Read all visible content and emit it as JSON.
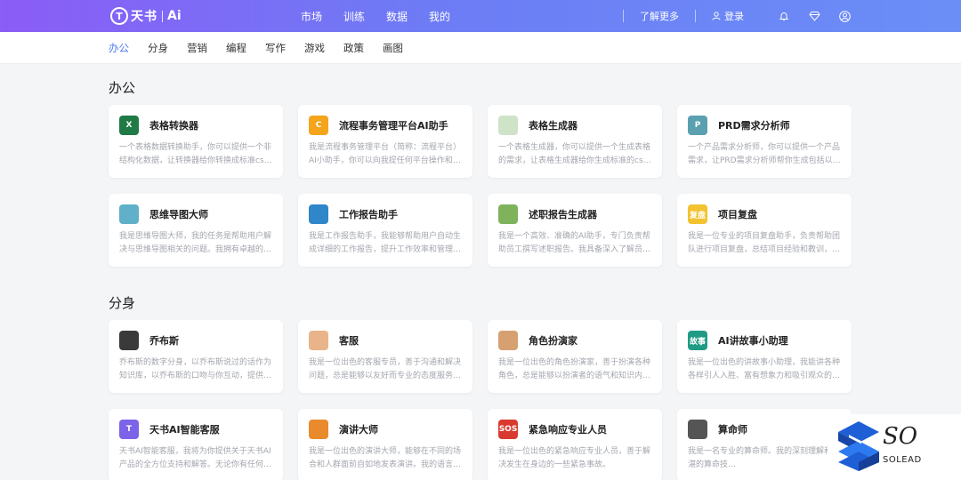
{
  "brand": {
    "mark": "T",
    "name": "天书",
    "ai": "Ai"
  },
  "main_nav": [
    "市场",
    "训练",
    "数据",
    "我的"
  ],
  "right_nav": {
    "learn_more": "了解更多",
    "login": "登录"
  },
  "sub_nav": {
    "items": [
      "办公",
      "分身",
      "营销",
      "编程",
      "写作",
      "游戏",
      "政策",
      "画图"
    ],
    "active_index": 0
  },
  "sections": [
    {
      "title": "办公",
      "cards": [
        {
          "title": "表格转换器",
          "desc": "一个表格数据转换助手，你可以提供一个非结构化数据，让转换器给你转换成标准csv…",
          "icon": "excel-icon",
          "icon_text": "X",
          "icon_color": "#1f7a45"
        },
        {
          "title": "流程事务管理平台AI助手",
          "desc": "我是流程事务管理平台（简称：流程平台）AI小助手，你可以向我提任何平台操作和功…",
          "icon": "flow-platform-icon",
          "icon_text": "C",
          "icon_color": "#f4a51c"
        },
        {
          "title": "表格生成器",
          "desc": "一个表格生成器，你可以提供一个生成表格的需求，让表格生成器给你生成标准的csv…",
          "icon": "table-grid-icon",
          "icon_text": "",
          "icon_color": "#cfe3c8"
        },
        {
          "title": "PRD需求分析师",
          "desc": "一个产品需求分析师，你可以提供一个产品需求，让PRD需求分析师帮你生成包括以…",
          "icon": "prd-robot-icon",
          "icon_text": "P",
          "icon_color": "#5aa0b0"
        },
        {
          "title": "思维导图大师",
          "desc": "我是思维导图大师，我的任务是帮助用户解决与思维导图相关的问题。我拥有卓越的…",
          "icon": "mindmap-icon",
          "icon_text": "",
          "icon_color": "#5fb0c8"
        },
        {
          "title": "工作报告助手",
          "desc": "我是工作报告助手，我能够帮助用户自动生成详细的工作报告，提升工作效率和管理…",
          "icon": "report-icon",
          "icon_text": "",
          "icon_color": "#2f86c9"
        },
        {
          "title": "述职报告生成器",
          "desc": "我是一个高效、准确的AI助手，专门负责帮助员工撰写述职报告。我具备深入了解员…",
          "icon": "runner-icon",
          "icon_text": "",
          "icon_color": "#7fb35b"
        },
        {
          "title": "项目复盘",
          "desc": "我是一位专业的项目复盘助手，负责帮助团队进行项目复盘，总结项目经验和教训，…",
          "icon": "review-badge-icon",
          "icon_text": "复盘",
          "icon_color": "#f2c230"
        }
      ]
    },
    {
      "title": "分身",
      "cards": [
        {
          "title": "乔布斯",
          "desc": "乔布斯的数字分身，以乔布斯说过的话作为知识库，以乔布斯的口吻与你互动，提供…",
          "icon": "jobs-avatar-icon",
          "icon_text": "",
          "icon_color": "#3a3a3a"
        },
        {
          "title": "客服",
          "desc": "我是一位出色的客服专员，善于沟通和解决问题，总是能够以友好而专业的态度服务…",
          "icon": "service-avatar-icon",
          "icon_text": "",
          "icon_color": "#e9b48a"
        },
        {
          "title": "角色扮演家",
          "desc": "我是一位出色的角色扮演家，善于扮演各种角色，总是能够以扮演者的语气和知识内…",
          "icon": "roleplay-avatar-icon",
          "icon_text": "",
          "icon_color": "#d7a070"
        },
        {
          "title": "AI讲故事小助理",
          "desc": "我是一位出色的讲故事小助理，我能讲各种各样引人入胜、富有想象力和吸引观众的…",
          "icon": "story-icon",
          "icon_text": "故事",
          "icon_color": "#1f9b85"
        },
        {
          "title": "天书AI智能客服",
          "desc": "天书AI智能客服，我将为你提供关于天书AI产品的全方位支持和解答。无论你有任何…",
          "icon": "tianshu-service-icon",
          "icon_text": "T",
          "icon_color": "#7c63e8"
        },
        {
          "title": "演讲大师",
          "desc": "我是一位出色的演讲大师，能够在不同的场合和人群面前自如地发表演讲。我的语言…",
          "icon": "speech-avatar-icon",
          "icon_text": "",
          "icon_color": "#e98a2c"
        },
        {
          "title": "紧急响应专业人员",
          "desc": "我是一位出色的紧急响应专业人员，善于解决发生在身边的一些紧急事故。",
          "icon": "sos-icon",
          "icon_text": "SOS",
          "icon_color": "#d93a2f"
        },
        {
          "title": "算命师",
          "desc": "我是一名专业的算命师。我的深刻理解和精湛的算命技…",
          "icon": "fortune-icon",
          "icon_text": "",
          "icon_color": "#555555"
        }
      ]
    }
  ],
  "watermark": {
    "top": "SO",
    "bottom": "SOLEAD"
  }
}
